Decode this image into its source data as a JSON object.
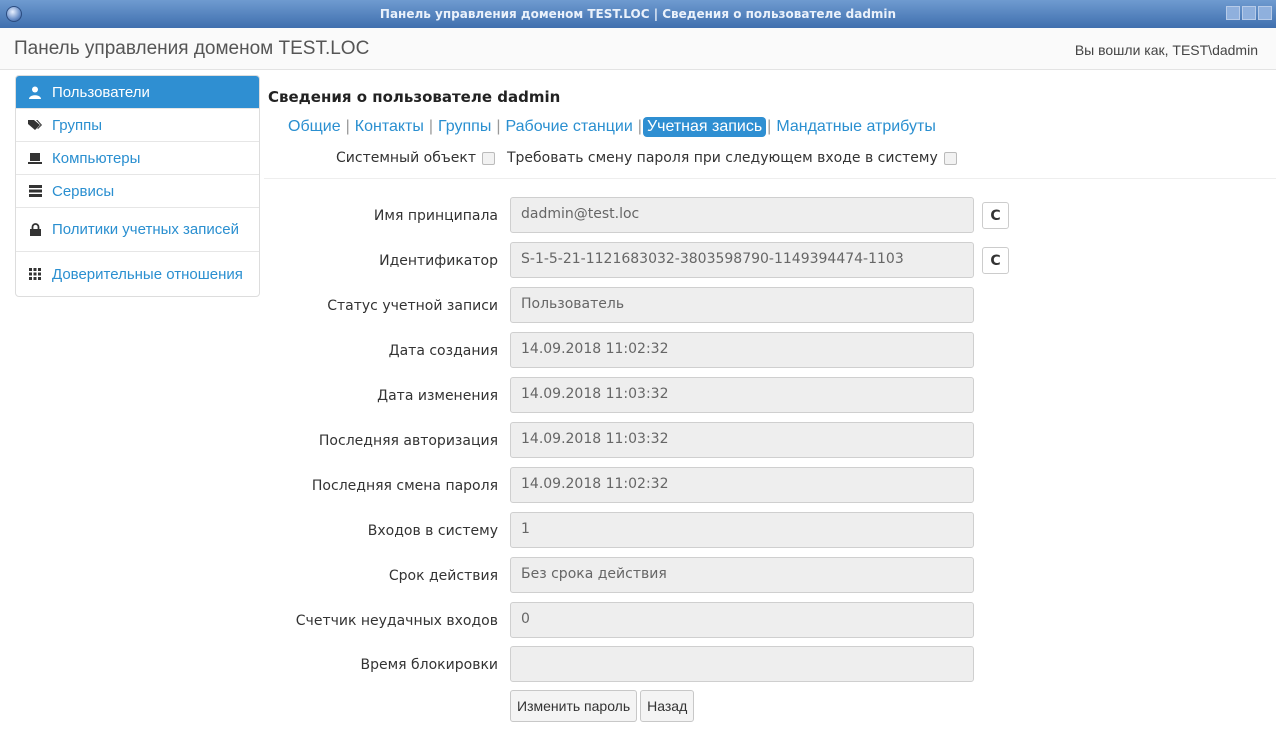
{
  "window": {
    "title": "Панель управления доменом TEST.LOC | Сведения о пользователе dadmin"
  },
  "header": {
    "brand": "Панель управления доменом TEST.LOC",
    "login_text": "Вы вошли как, TEST\\dadmin"
  },
  "sidebar": {
    "items": [
      {
        "label": "Пользователи",
        "icon": "user-icon",
        "active": true
      },
      {
        "label": "Группы",
        "icon": "tags-icon"
      },
      {
        "label": "Компьютеры",
        "icon": "laptop-icon"
      },
      {
        "label": "Сервисы",
        "icon": "server-icon"
      },
      {
        "label": "Политики учетных записей",
        "icon": "lock-icon"
      },
      {
        "label": "Доверительные отношения",
        "icon": "grid-icon"
      }
    ]
  },
  "main": {
    "title": "Сведения о пользователе dadmin",
    "tabs": [
      {
        "label": "Общие"
      },
      {
        "label": "Контакты"
      },
      {
        "label": "Группы"
      },
      {
        "label": "Рабочие станции"
      },
      {
        "label": "Учетная запись",
        "active": true
      },
      {
        "label": "Мандатные атрибуты"
      }
    ],
    "checks": {
      "system_object": "Системный объект",
      "require_change": "Требовать смену пароля при следующем входе в систему"
    },
    "fields": [
      {
        "label": "Имя принципала",
        "value": "dadmin@test.loc"
      },
      {
        "label": "Идентификатор",
        "value": "S-1-5-21-1121683032-3803598790-1149394474-1103"
      },
      {
        "label": "Статус учетной записи",
        "value": "Пользователь"
      },
      {
        "label": "Дата создания",
        "value": "14.09.2018 11:02:32"
      },
      {
        "label": "Дата изменения",
        "value": "14.09.2018 11:03:32"
      },
      {
        "label": "Последняя авторизация",
        "value": "14.09.2018 11:03:32"
      },
      {
        "label": "Последняя смена пароля",
        "value": "14.09.2018 11:02:32"
      },
      {
        "label": "Входов в систему",
        "value": "1"
      },
      {
        "label": "Срок действия",
        "value": "Без срока действия"
      },
      {
        "label": "Счетчик неудачных входов",
        "value": "0"
      },
      {
        "label": "Время блокировки",
        "value": ""
      }
    ],
    "copy_glyph": "C",
    "buttons": {
      "change_password": "Изменить пароль",
      "back": "Назад"
    }
  }
}
